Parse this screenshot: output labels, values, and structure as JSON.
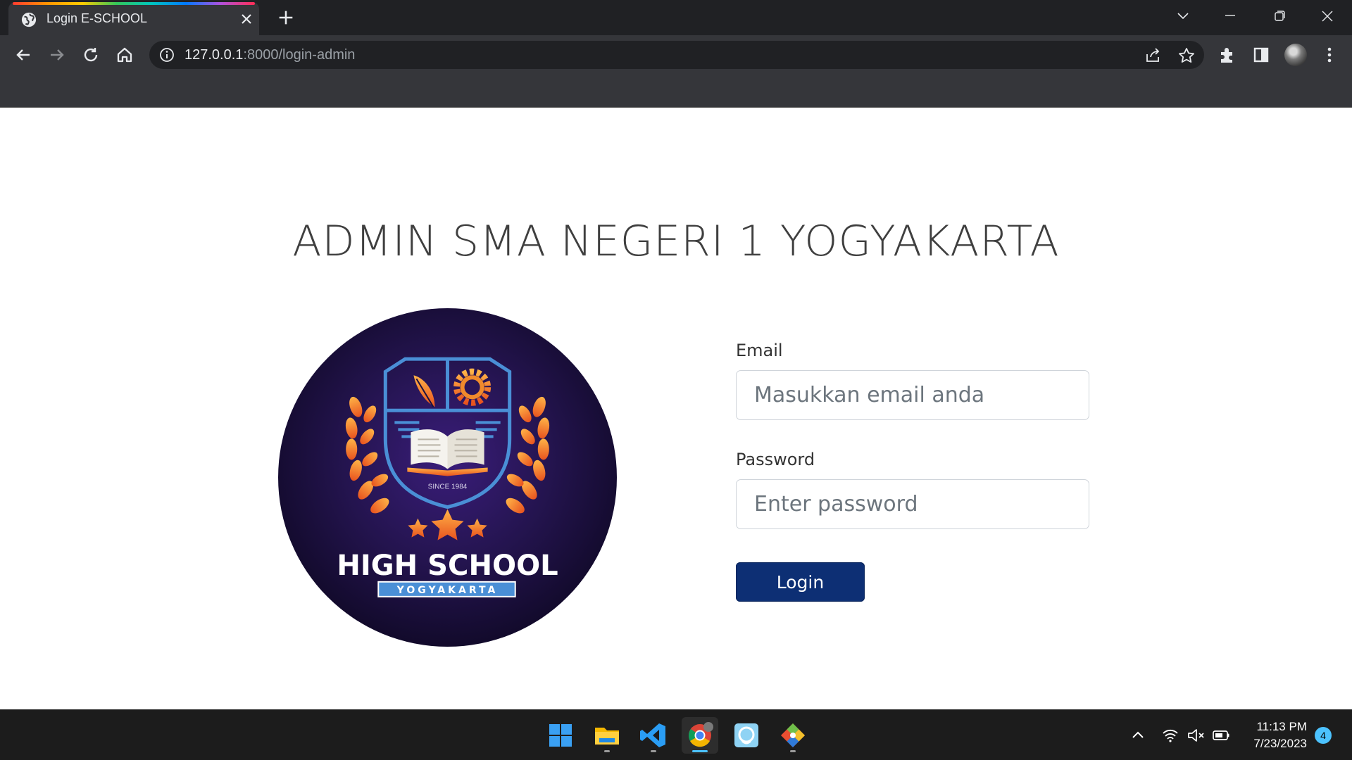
{
  "browser": {
    "tab_title": "Login E-SCHOOL",
    "url_host": "127.0.0.1",
    "url_rest": ":8000/login-admin"
  },
  "page": {
    "title": "ADMIN SMA NEGERI 1 YOGYAKARTA",
    "logo": {
      "since_text": "SINCE 1984",
      "main_text": "HIGH SCHOOL",
      "sub_text": "YOGYAKARTA"
    },
    "form": {
      "email_label": "Email",
      "email_placeholder": "Masukkan email anda",
      "password_label": "Password",
      "password_placeholder": "Enter password",
      "login_label": "Login"
    }
  },
  "taskbar": {
    "apps": [
      "start-icon",
      "file-explorer-icon",
      "vscode-icon",
      "chrome-icon",
      "app-icon",
      "git-icon"
    ],
    "time": "11:13 PM",
    "date": "7/23/2023",
    "notification_count": "4"
  },
  "colors": {
    "login_button": "#0d2f74",
    "logo_background": "#1a1140",
    "logo_accent": "#f08a2c",
    "taskbar_accent": "#4cc2ff"
  }
}
